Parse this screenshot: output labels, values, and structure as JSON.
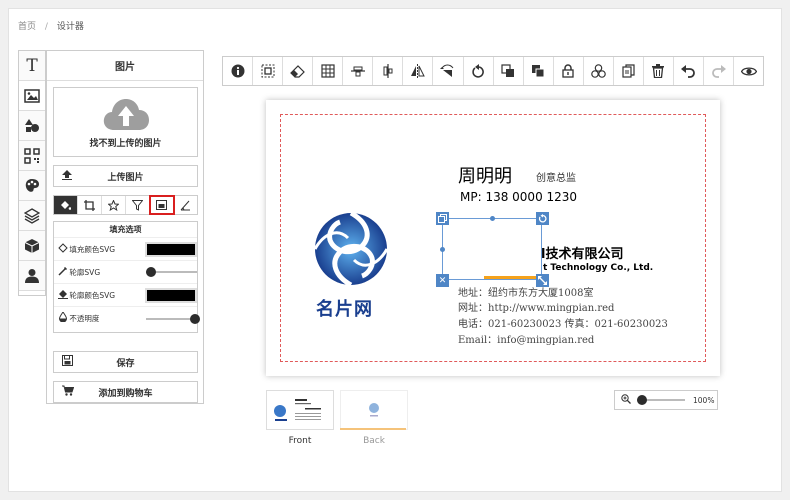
{
  "breadcrumb": {
    "home": "首页",
    "separator": "/",
    "current": "设计器"
  },
  "side_tools": [
    {
      "name": "text-tool-icon",
      "glyph": "T"
    },
    {
      "name": "image-tool-icon",
      "glyph": "▣"
    },
    {
      "name": "shapes-tool-icon",
      "glyph": "◆"
    },
    {
      "name": "qrcode-tool-icon",
      "glyph": "▦"
    },
    {
      "name": "clipart-tool-icon",
      "glyph": "✿"
    },
    {
      "name": "layers-tool-icon",
      "glyph": "≋"
    },
    {
      "name": "templates-tool-icon",
      "glyph": "⬢"
    },
    {
      "name": "user-tool-icon",
      "glyph": "●"
    }
  ],
  "panel": {
    "title": "图片",
    "upload_hint": "找不到上传的图片",
    "upload_button": "上传图片",
    "fill_options_title": "填充选项",
    "fill_color_label": "填充颜色SVG",
    "stroke_label": "轮廓SVG",
    "stroke_color_label": "轮廓颜色SVG",
    "opacity_label": "不透明度",
    "save_button": "保存",
    "add_to_cart_button": "添加到购物车"
  },
  "toolbar": [
    "info",
    "select-all",
    "eraser",
    "grid",
    "align-center-v",
    "align-center-h",
    "flip-horizontal",
    "flip-vertical",
    "rotate",
    "bring-forward",
    "send-backward",
    "lock",
    "group",
    "duplicate",
    "delete",
    "undo",
    "redo",
    "preview"
  ],
  "card": {
    "logo_text": "名片网",
    "name": "周明明",
    "title": "创意总监",
    "mobile": "MP: 138 0000 1230",
    "company_cn_partial": "l技术有限公司",
    "company_en_partial": "t Technology Co., Ltd.",
    "address": "地址：纽约市东方大厦1008室",
    "website": "网址：http://www.mingpian.red",
    "phone": "电话：021-60230023  传真：021-60230023",
    "email": "Email：info@mingpian.red"
  },
  "pages": {
    "front_label": "Front",
    "back_label": "Back"
  },
  "zoom": {
    "value_label": "100%"
  },
  "colors": {
    "selection_blue": "#4f86c6",
    "bleed_red": "#e05a5a",
    "logo_blue": "#1a3f8f",
    "accent_orange": "#f5a21b"
  }
}
